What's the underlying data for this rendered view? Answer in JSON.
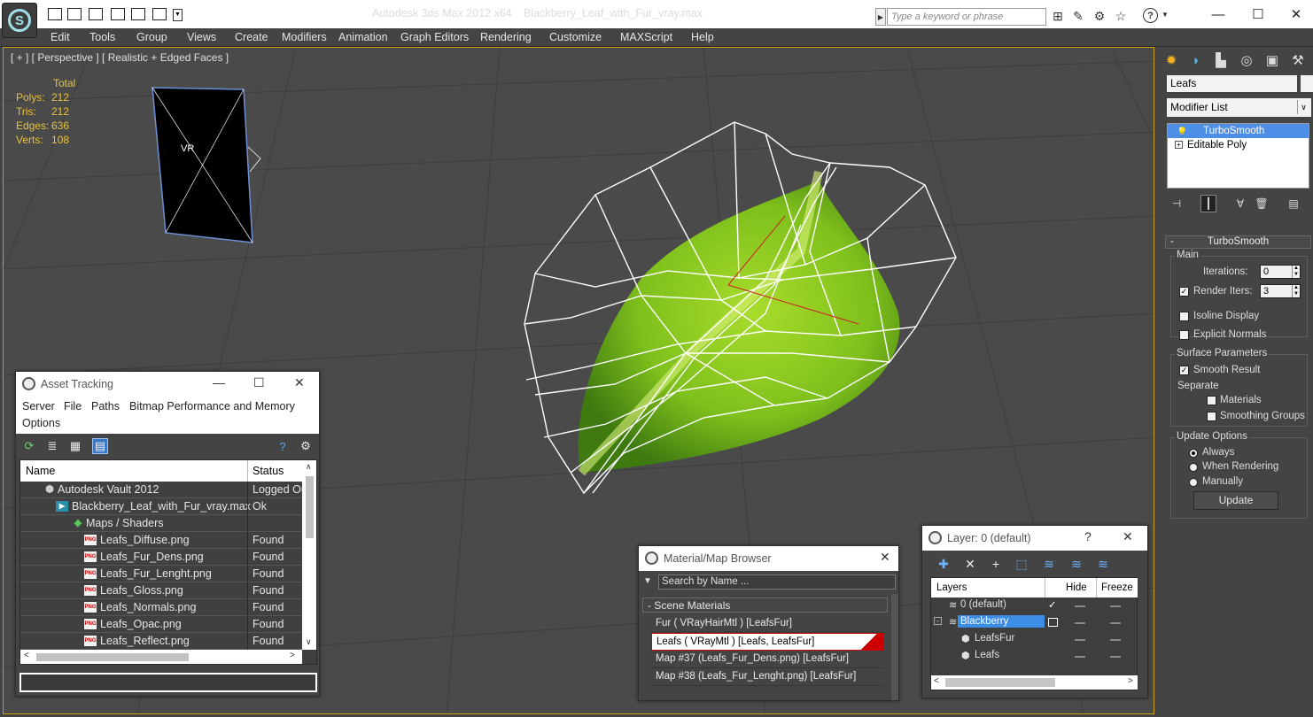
{
  "app": {
    "title": "Autodesk 3ds Max  2012 x64",
    "file": "Blackberry_Leaf_with_Fur_vray.max",
    "search_placeholder": "Type a keyword or phrase"
  },
  "menu": [
    "Edit",
    "Tools",
    "Group",
    "Views",
    "Create",
    "Modifiers",
    "Animation",
    "Graph Editors",
    "Rendering",
    "Customize",
    "MAXScript",
    "Help"
  ],
  "viewport": {
    "label": "[ + ] [ Perspective ] [ Realistic + Edged Faces ]",
    "stats_header": "Total",
    "stats": [
      {
        "label": "Polys:",
        "value": "212"
      },
      {
        "label": "Tris:",
        "value": "212"
      },
      {
        "label": "Edges:",
        "value": "636"
      },
      {
        "label": "Verts:",
        "value": "108"
      }
    ],
    "camera_label": "VR"
  },
  "command_panel": {
    "object_name": "Leafs",
    "modifier_list": "Modifier List",
    "stack": [
      {
        "label": "TurboSmooth",
        "selected": true
      },
      {
        "label": "Editable Poly",
        "selected": false
      }
    ],
    "rollout_title": "TurboSmooth",
    "main_group": "Main",
    "iterations_label": "Iterations:",
    "iterations_value": "0",
    "render_iters_label": "Render Iters:",
    "render_iters_value": "3",
    "isoline_label": "Isoline Display",
    "explicit_normals_label": "Explicit Normals",
    "surface_group": "Surface Parameters",
    "smooth_result_label": "Smooth Result",
    "separate_label": "Separate",
    "materials_label": "Materials",
    "smoothing_groups_label": "Smoothing Groups",
    "update_group": "Update Options",
    "always_label": "Always",
    "when_rendering_label": "When Rendering",
    "manually_label": "Manually",
    "update_button": "Update"
  },
  "asset_tracking": {
    "title": "Asset Tracking",
    "menu": [
      "Server",
      "File",
      "Paths",
      "Bitmap Performance and Memory"
    ],
    "menu_options": "Options",
    "col_name": "Name",
    "col_status": "Status",
    "rows": [
      {
        "name": "Autodesk Vault 2012",
        "status": "Logged Out"
      },
      {
        "name": "Blackberry_Leaf_with_Fur_vray.max",
        "status": "Ok"
      },
      {
        "name": "Maps / Shaders",
        "status": ""
      },
      {
        "name": "Leafs_Diffuse.png",
        "status": "Found"
      },
      {
        "name": "Leafs_Fur_Dens.png",
        "status": "Found"
      },
      {
        "name": "Leafs_Fur_Lenght.png",
        "status": "Found"
      },
      {
        "name": "Leafs_Gloss.png",
        "status": "Found"
      },
      {
        "name": "Leafs_Normals.png",
        "status": "Found"
      },
      {
        "name": "Leafs_Opac.png",
        "status": "Found"
      },
      {
        "name": "Leafs_Reflect.png",
        "status": "Found"
      }
    ]
  },
  "material_browser": {
    "title": "Material/Map Browser",
    "search_placeholder": "Search by Name ...",
    "section": "Scene Materials",
    "items": [
      "Fur  ( VRayHairMtl )  [LeafsFur]",
      "Leafs  ( VRayMtl )  [Leafs, LeafsFur]",
      "Map #37 (Leafs_Fur_Dens.png)  [LeafsFur]",
      "Map #38 (Leafs_Fur_Lenght.png)  [LeafsFur]"
    ]
  },
  "layer_window": {
    "title": "Layer: 0 (default)",
    "help": "?",
    "col_layers": "Layers",
    "col_hide": "Hide",
    "col_freeze": "Freeze",
    "rows": [
      {
        "name": "0 (default)"
      },
      {
        "name": "Blackberry"
      },
      {
        "name": "LeafsFur"
      },
      {
        "name": "Leafs"
      }
    ]
  }
}
